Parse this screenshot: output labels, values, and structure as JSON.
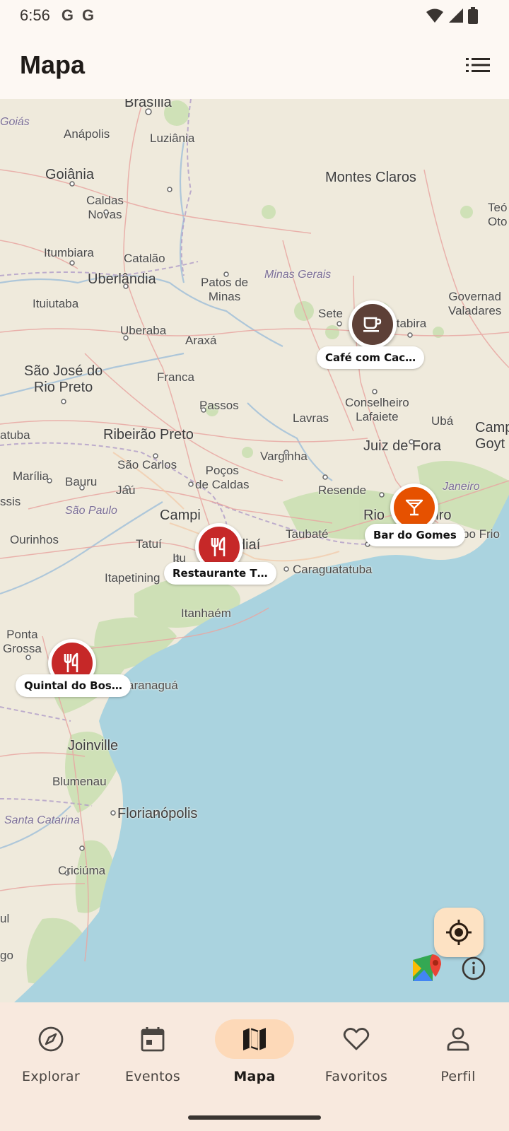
{
  "status_bar": {
    "time": "6:56",
    "g1": "G",
    "g2": "G"
  },
  "app_bar": {
    "title": "Mapa"
  },
  "map": {
    "cities": [
      {
        "name": "Brasília"
      },
      {
        "name": "Goiás"
      },
      {
        "name": "Anápolis"
      },
      {
        "name": "Luziânia"
      },
      {
        "name": "Goiânia"
      },
      {
        "name": "Montes Claros"
      },
      {
        "name": "Caldas\nNovas"
      },
      {
        "name": "Teó\nOto"
      },
      {
        "name": "Itumbiara"
      },
      {
        "name": "Catalão"
      },
      {
        "name": "Minas Gerais"
      },
      {
        "name": "Uberlândia"
      },
      {
        "name": "Patos de\nMinas"
      },
      {
        "name": "Ituiutaba"
      },
      {
        "name": "Governad\nValadares"
      },
      {
        "name": "Sete"
      },
      {
        "name": "Uberaba"
      },
      {
        "name": "Araxá"
      },
      {
        "name": "Itabira"
      },
      {
        "name": "São José do\nRio Preto"
      },
      {
        "name": "Franca"
      },
      {
        "name": "Passos"
      },
      {
        "name": "Conselheiro\nLafaiete"
      },
      {
        "name": "Lavras"
      },
      {
        "name": "Ubá"
      },
      {
        "name": "Camp\nGoyt"
      },
      {
        "name": "atuba"
      },
      {
        "name": "Ribeirão Preto"
      },
      {
        "name": "Juiz de Fora"
      },
      {
        "name": "Varginha"
      },
      {
        "name": "São Carlos"
      },
      {
        "name": "Poços\nde Caldas"
      },
      {
        "name": "Marília"
      },
      {
        "name": "Bauru"
      },
      {
        "name": "Jaú"
      },
      {
        "name": "Resende"
      },
      {
        "name": "Janeiro"
      },
      {
        "name": "ssis"
      },
      {
        "name": "São Paulo"
      },
      {
        "name": "Campi"
      },
      {
        "name": "Rio"
      },
      {
        "name": "neiro"
      },
      {
        "name": "Taubaté"
      },
      {
        "name": "bo Frio"
      },
      {
        "name": "Ourinhos"
      },
      {
        "name": "Tatuí"
      },
      {
        "name": "Itu"
      },
      {
        "name": "diaí"
      },
      {
        "name": "Caraguatatuba"
      },
      {
        "name": "Itapetining"
      },
      {
        "name": "Itanhaém"
      },
      {
        "name": "Ponta\nGrossa"
      },
      {
        "name": "aranaguá"
      },
      {
        "name": "Joinville"
      },
      {
        "name": "Blumenau"
      },
      {
        "name": "Florianópolis"
      },
      {
        "name": "Santa Catarina"
      },
      {
        "name": "Criciúma"
      },
      {
        "name": "ul"
      },
      {
        "name": "go"
      }
    ],
    "markers": [
      {
        "label": "Café com Cac…",
        "icon": "coffee-icon",
        "color": "#5d4037"
      },
      {
        "label": "Bar do Gomes",
        "icon": "cocktail-icon",
        "color": "#e65100"
      },
      {
        "label": "Restaurante T…",
        "icon": "restaurant-icon",
        "color": "#c62828"
      },
      {
        "label": "Quintal do Bos…",
        "icon": "restaurant-icon",
        "color": "#c62828"
      }
    ]
  },
  "bottom_nav": {
    "items": [
      {
        "label": "Explorar",
        "icon": "compass-icon"
      },
      {
        "label": "Eventos",
        "icon": "calendar-icon"
      },
      {
        "label": "Mapa",
        "icon": "map-icon",
        "active": true
      },
      {
        "label": "Favoritos",
        "icon": "heart-icon"
      },
      {
        "label": "Perfil",
        "icon": "person-icon"
      }
    ]
  },
  "colors": {
    "background": "#fdf8f3",
    "nav_background": "#f8e9de",
    "active_pill": "#fdd9b8",
    "locate_button": "#fde2c3",
    "ocean": "#aad3df",
    "land": "#efeadc"
  }
}
